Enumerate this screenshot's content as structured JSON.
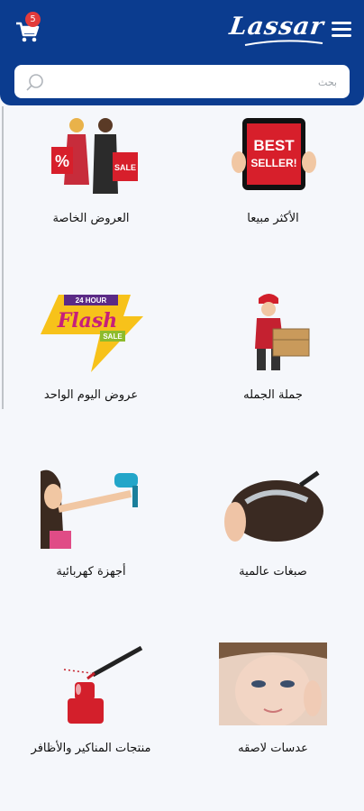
{
  "header": {
    "logo_text": "Lassar",
    "cart_count": "5",
    "bg_color": "#0b3c8f",
    "menu_icon": "hamburger-menu-icon",
    "cart_icon": "shopping-cart-icon"
  },
  "search": {
    "placeholder": "بحث",
    "icon": "search-icon"
  },
  "categories": [
    {
      "label": "الأكثر مبيعا"
    },
    {
      "label": "العروض الخاصة"
    },
    {
      "label": "جملة الجمله"
    },
    {
      "label": "عروض اليوم الواحد"
    },
    {
      "label": "صبغات عالمية"
    },
    {
      "label": "أجهزة كهربائية"
    },
    {
      "label": "عدسات لاصقه"
    },
    {
      "label": "منتجات المناكير والأظافر"
    }
  ],
  "images": {
    "best_seller": {
      "line1": "BEST",
      "line2": "SELLER!"
    },
    "special_offers": {
      "percent": "%",
      "sale": "SALE"
    },
    "flash_sale": {
      "top": "24 HOUR",
      "main": "Flash",
      "bottom": "SALE"
    }
  }
}
